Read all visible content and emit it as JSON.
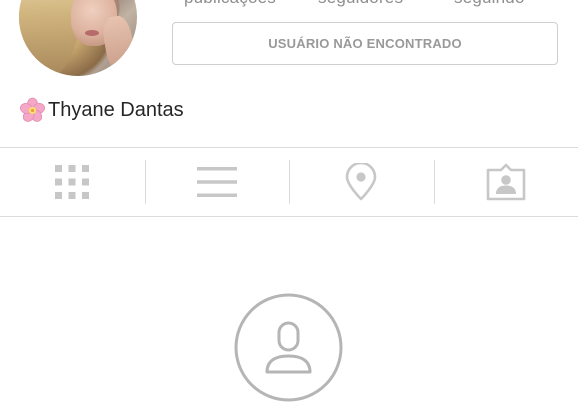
{
  "profile": {
    "stats": {
      "posts_label": "publicações",
      "followers_label": "seguidores",
      "following_label": "seguindo"
    },
    "user_button_label": "USUÁRIO NÃO ENCONTRADO",
    "name": "Thyane Dantas",
    "name_emoji_icon": "cherry-blossom-icon"
  },
  "tabs": [
    {
      "icon": "grid-icon"
    },
    {
      "icon": "list-icon"
    },
    {
      "icon": "location-pin-icon"
    },
    {
      "icon": "tagged-person-icon"
    }
  ],
  "empty_state": {
    "icon": "person-circle-icon"
  },
  "colors": {
    "border": "#dbdbdb",
    "icon_gray": "#c7c7c7",
    "button_text": "#999999",
    "flower_pink": "#f4a7c6"
  }
}
